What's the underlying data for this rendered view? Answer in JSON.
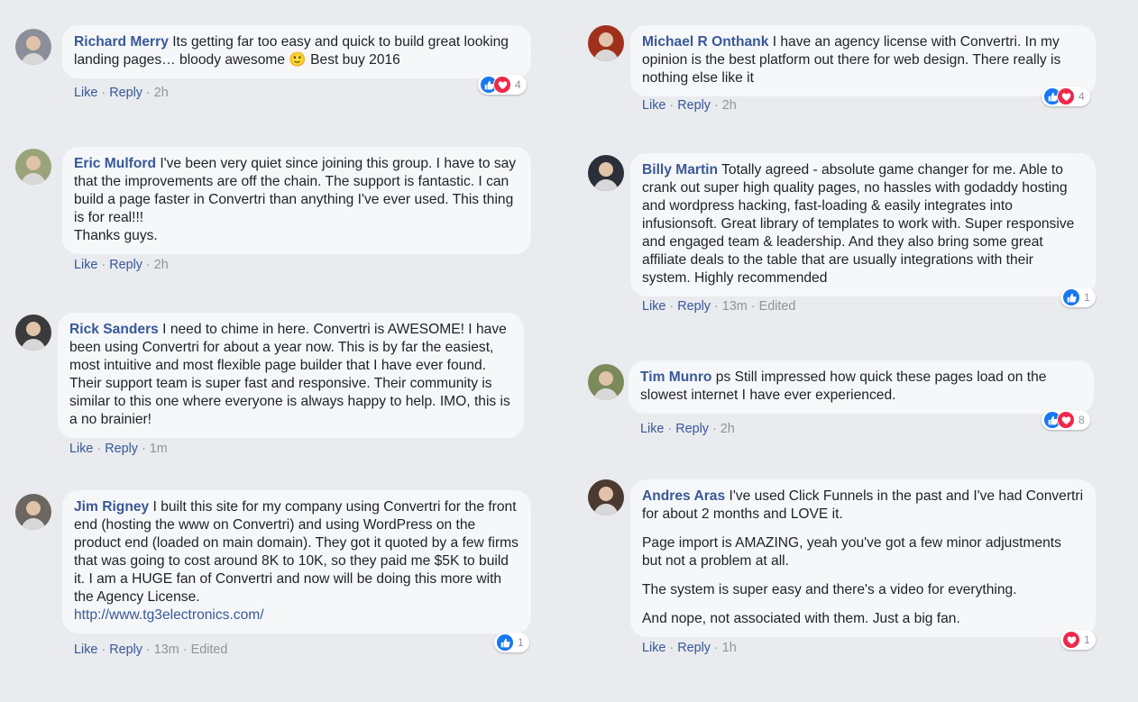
{
  "comments": [
    {
      "author": "Richard Merry",
      "paragraphs": [
        "Its getting far too easy and quick to build great looking landing pages… bloody awesome 🙂 Best buy 2016"
      ],
      "link": "",
      "actions": {
        "like": "Like",
        "reply": "Reply",
        "time": "2h",
        "edited": ""
      },
      "reactions": {
        "types": [
          "like",
          "love"
        ],
        "count": "4"
      },
      "avatar_color": "#8a8f99"
    },
    {
      "author": "Eric Mulford",
      "paragraphs": [
        "I've been very quiet since joining this group. I have to say that the improvements are off the chain. The support is fantastic. I can build a page faster in Convertri than anything I've ever used. This thing is for real!!!\nThanks guys."
      ],
      "link": "",
      "actions": {
        "like": "Like",
        "reply": "Reply",
        "time": "2h",
        "edited": ""
      },
      "reactions": null,
      "avatar_color": "#9aa37a"
    },
    {
      "author": "Rick Sanders",
      "paragraphs": [
        "I need to chime in here. Convertri is AWESOME! I have been using Convertri for about a year now. This is by far the easiest, most intuitive and most flexible page builder that I have ever found. Their support team is super fast and responsive. Their community is similar to this one where everyone is always happy to help. IMO, this is a no brainier!"
      ],
      "link": "",
      "actions": {
        "like": "Like",
        "reply": "Reply",
        "time": "1m",
        "edited": ""
      },
      "reactions": null,
      "avatar_color": "#3b3b3b"
    },
    {
      "author": "Jim Rigney",
      "paragraphs": [
        "I built this site for my company using Convertri for the front end (hosting the www on Convertri) and using WordPress on the product end (loaded on main domain). They got it quoted by a few firms that was going to cost around 8K to 10K, so they paid me $5K to build it. I am a HUGE fan of Convertri and now will be doing this more with the Agency License."
      ],
      "link": "http://www.tg3electronics.com/",
      "actions": {
        "like": "Like",
        "reply": "Reply",
        "time": "13m",
        "edited": "Edited"
      },
      "reactions": {
        "types": [
          "like"
        ],
        "count": "1"
      },
      "avatar_color": "#6b6660"
    },
    {
      "author": "Michael R Onthank",
      "paragraphs": [
        "I have an agency license with Convertri. In my opinion is the best platform out there for web design. There really is nothing else like it"
      ],
      "link": "",
      "actions": {
        "like": "Like",
        "reply": "Reply",
        "time": "2h",
        "edited": ""
      },
      "reactions": {
        "types": [
          "like",
          "love"
        ],
        "count": "4"
      },
      "avatar_color": "#a0301c"
    },
    {
      "author": "Billy Martin",
      "paragraphs": [
        "Totally agreed - absolute game changer for me. Able to crank out super high quality pages, no hassles with godaddy hosting and wordpress hacking, fast-loading & easily integrates into infusionsoft. Great library of templates to work with. Super responsive and engaged team & leadership. And they also bring some great affiliate deals to the table that are usually integrations with their system. Highly recommended"
      ],
      "link": "",
      "actions": {
        "like": "Like",
        "reply": "Reply",
        "time": "13m",
        "edited": "Edited"
      },
      "reactions": {
        "types": [
          "like"
        ],
        "count": "1"
      },
      "avatar_color": "#2a2f3a"
    },
    {
      "author": "Tim Munro",
      "paragraphs": [
        "ps Still impressed how quick these pages load on the slowest internet I have ever experienced."
      ],
      "link": "",
      "actions": {
        "like": "Like",
        "reply": "Reply",
        "time": "2h",
        "edited": ""
      },
      "reactions": {
        "types": [
          "like",
          "love"
        ],
        "count": "8"
      },
      "avatar_color": "#7a8a5a"
    },
    {
      "author": "Andres Aras",
      "paragraphs": [
        "I've used Click Funnels in the past and I've had Convertri for about 2 months and LOVE it.",
        "Page import is AMAZING, yeah you've got a few minor adjustments but not a problem at all.",
        "The system is super easy and there's a video for everything.",
        "And nope, not associated with them. Just a big fan."
      ],
      "link": "",
      "actions": {
        "like": "Like",
        "reply": "Reply",
        "time": "1h",
        "edited": ""
      },
      "reactions": {
        "types": [
          "love"
        ],
        "count": "1"
      },
      "avatar_color": "#4a3a30"
    }
  ],
  "colors": {
    "background": "#e9ebee",
    "bubble": "#f6f7f9",
    "author": "#385898",
    "text": "#1d2129",
    "meta": "#90949c",
    "like": "#1877f2",
    "love": "#f0284a"
  }
}
